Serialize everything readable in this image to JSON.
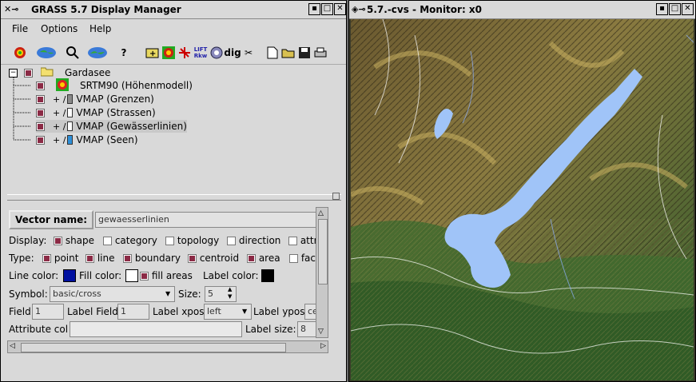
{
  "dm": {
    "title": "GRASS 5.7 Display Manager",
    "menu": [
      "File",
      "Options",
      "Help"
    ],
    "tools": [
      "add-raster-icon",
      "zoom-icon",
      "search-icon",
      "layers-icon",
      "help-icon",
      "add-group-icon",
      "raster-icon",
      "vector-icon",
      "legend-icon",
      "barscale-icon",
      "dig-icon",
      "cut-icon",
      "new-icon",
      "open-icon",
      "save-icon",
      "print-icon"
    ],
    "tool_glyphs": [
      "✦",
      "◍",
      "🔍",
      "◍",
      "?",
      "⊞",
      "●",
      "✈",
      "LIFT",
      "✿",
      "dig",
      "✂",
      "▯",
      "📂",
      "▪",
      "⎙"
    ],
    "tree": {
      "group": "Gardasee",
      "layers": [
        {
          "label": "SRTM90 (Höhenmodell)",
          "type": "raster",
          "checked": true
        },
        {
          "label": "VMAP (Grenzen)",
          "type": "vector",
          "checked": true,
          "color": "#8a8a8a"
        },
        {
          "label": "VMAP (Strassen)",
          "type": "vector",
          "checked": true,
          "color": "#ffffff"
        },
        {
          "label": "VMAP (Gewässerlinien)",
          "type": "vector",
          "checked": true,
          "color": "#ffffff"
        },
        {
          "label": "VMAP (Seen)",
          "type": "vector",
          "checked": true,
          "color": "#2e8fd8"
        }
      ],
      "vector_prefix": "+ /"
    },
    "props": {
      "vector_name_btn": "Vector name:",
      "vector_name_value": "gewaesserlinien",
      "display_label": "Display:",
      "display_opts": [
        {
          "label": "shape",
          "checked": true
        },
        {
          "label": "category",
          "checked": false
        },
        {
          "label": "topology",
          "checked": false
        },
        {
          "label": "direction",
          "checked": false
        },
        {
          "label": "attrib",
          "checked": false
        }
      ],
      "type_label": "Type:",
      "type_opts": [
        {
          "label": "point",
          "checked": true
        },
        {
          "label": "line",
          "checked": true
        },
        {
          "label": "boundary",
          "checked": true
        },
        {
          "label": "centroid",
          "checked": true
        },
        {
          "label": "area",
          "checked": true
        },
        {
          "label": "face",
          "checked": false
        }
      ],
      "line_color_label": "Line color:",
      "line_color": "#0010a0",
      "fill_color_label": "Fill color:",
      "fill_color": "#ffffff",
      "fill_areas_label": "fill areas",
      "fill_areas_checked": true,
      "label_color_label": "Label color:",
      "label_color": "#000000",
      "symbol_label": "Symbol:",
      "symbol_value": "basic/cross",
      "size_label": "Size:",
      "size_value": "5",
      "field_label": "Field",
      "field_value": "1",
      "label_field_label": "Label Field",
      "label_field_value": "1",
      "label_xpos_label": "Label xpos",
      "label_xpos_value": "left",
      "label_ypos_label": "Label ypos",
      "label_ypos_value": "cent",
      "attribute_col_label": "Attribute col",
      "attribute_col_value": "",
      "label_size_label": "Label size:",
      "label_size_value": "8"
    }
  },
  "monitor": {
    "title": "5.7.-cvs - Monitor: x0"
  }
}
